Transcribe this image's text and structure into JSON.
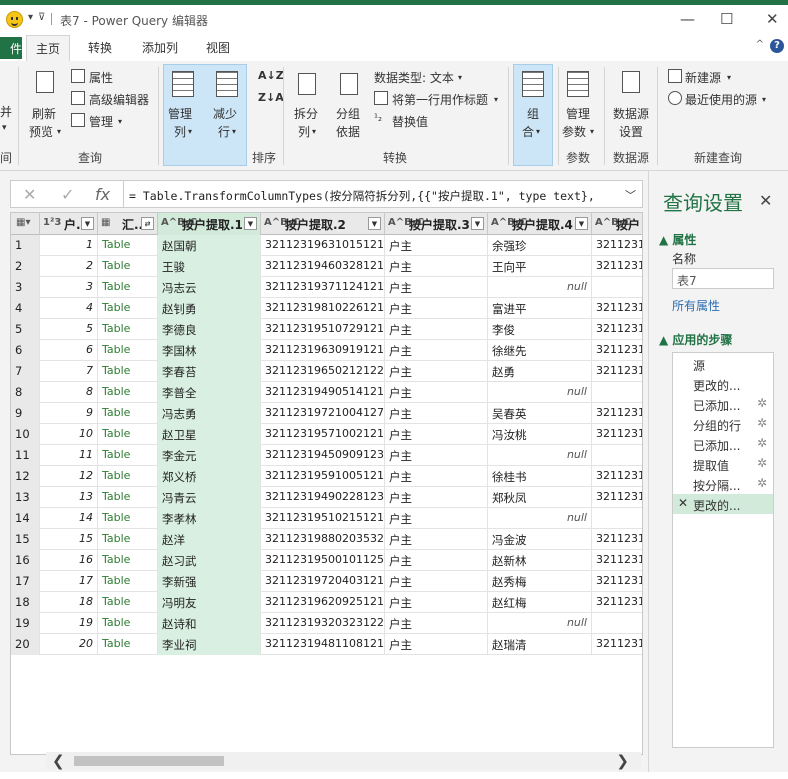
{
  "window": {
    "title": "表7 - Power Query 编辑器",
    "minimize": "—",
    "maximize": "☐",
    "close": "✕"
  },
  "tabs": {
    "file": "件",
    "items": [
      "主页",
      "转换",
      "添加列",
      "视图"
    ]
  },
  "ribbon": {
    "left_edge": [
      "并",
      "▾"
    ],
    "refresh": "刷新",
    "preview": "预览",
    "properties": "属性",
    "advanced_editor": "高级编辑器",
    "manage": "管理",
    "query_group": "查询",
    "manage_columns": "管理",
    "manage_columns2": "列",
    "reduce_rows": "减少",
    "reduce_rows2": "行",
    "sort_group": "排序",
    "split": "拆分",
    "split2": "列",
    "group_by": "分组",
    "group_by2": "依据",
    "data_type": "数据类型: 文本",
    "first_row_header": "将第一行用作标题",
    "replace_values": "替换值",
    "transform_group": "转换",
    "combine": "组",
    "combine2": "合",
    "manage_params": "管理",
    "manage_params2": "参数",
    "params_group": "参数",
    "data_source": "数据源",
    "data_source2": "设置",
    "datasource_group": "数据源",
    "new_source": "新建源",
    "recent_sources": "最近使用的源",
    "new_query_group": "新建查询",
    "left_group": "间"
  },
  "formula": {
    "cancel": "✕",
    "confirm": "✓",
    "fx": "fx",
    "text": "= Table.TransformColumnTypes(按分隔符拆分列,{{\"按户提取.1\", type text},",
    "dropdown": "﹀"
  },
  "columns": [
    {
      "type": "1²3",
      "name": "户..."
    },
    {
      "type": "▦",
      "name": "汇..."
    },
    {
      "type": "A^B_C",
      "name": "按户提取.1"
    },
    {
      "type": "A^B_C",
      "name": "按户提取.2"
    },
    {
      "type": "A^B_C",
      "name": "按户提取.3"
    },
    {
      "type": "A^B_C",
      "name": "按户提取.4"
    },
    {
      "type": "A^B_C",
      "name": "按户"
    }
  ],
  "table_label": "Table",
  "null_label": "null",
  "rows": [
    {
      "n": "1",
      "num": "1",
      "c1": "赵国朝",
      "c2": "321123196310151215",
      "c3": "户主",
      "c4": "余强珍",
      "c5": "32112319"
    },
    {
      "n": "2",
      "num": "2",
      "c1": "王骏",
      "c2": "321123194603281217",
      "c3": "户主",
      "c4": "王向平",
      "c5": "32112319"
    },
    {
      "n": "3",
      "num": "3",
      "c1": "冯志云",
      "c2": "321123193711241218",
      "c3": "户主",
      "c4": "",
      "c5": ""
    },
    {
      "n": "4",
      "num": "4",
      "c1": "赵钊勇",
      "c2": "321123198102261216",
      "c3": "户主",
      "c4": "富进平",
      "c5": "32112319"
    },
    {
      "n": "5",
      "num": "5",
      "c1": "李德良",
      "c2": "321123195107291218",
      "c3": "户主",
      "c4": "李俊",
      "c5": "32112319"
    },
    {
      "n": "6",
      "num": "6",
      "c1": "李国林",
      "c2": "32112319630919121X",
      "c3": "户主",
      "c4": "徐继先",
      "c5": "32112319"
    },
    {
      "n": "7",
      "num": "7",
      "c1": "李春苔",
      "c2": "321123196502121221",
      "c3": "户主",
      "c4": "赵勇",
      "c5": "32112319"
    },
    {
      "n": "8",
      "num": "8",
      "c1": "李普全",
      "c2": "32112319490514121X",
      "c3": "户主",
      "c4": "",
      "c5": ""
    },
    {
      "n": "9",
      "num": "9",
      "c1": "冯志勇",
      "c2": "321123197210041275",
      "c3": "户主",
      "c4": "吴春英",
      "c5": "32112319"
    },
    {
      "n": "10",
      "num": "10",
      "c1": "赵卫星",
      "c2": "321123195710021212",
      "c3": "户主",
      "c4": "冯汝桃",
      "c5": "32112319"
    },
    {
      "n": "11",
      "num": "11",
      "c1": "李金元",
      "c2": "321123194509091230",
      "c3": "户主",
      "c4": "",
      "c5": ""
    },
    {
      "n": "12",
      "num": "12",
      "c1": "郑义桥",
      "c2": "321123195910051213",
      "c3": "户主",
      "c4": "徐桂书",
      "c5": "32112319"
    },
    {
      "n": "13",
      "num": "13",
      "c1": "冯青云",
      "c2": "321123194902281233",
      "c3": "户主",
      "c4": "郑秋凤",
      "c5": "32112319"
    },
    {
      "n": "14",
      "num": "14",
      "c1": "李孝林",
      "c2": "321123195102151216",
      "c3": "户主",
      "c4": "",
      "c5": ""
    },
    {
      "n": "15",
      "num": "15",
      "c1": "赵洋",
      "c2": "32112319880203532X",
      "c3": "户主",
      "c4": "冯金波",
      "c5": "32112319"
    },
    {
      "n": "16",
      "num": "16",
      "c1": "赵习武",
      "c2": "321123195001011257",
      "c3": "户主",
      "c4": "赵新林",
      "c5": "32112319"
    },
    {
      "n": "17",
      "num": "17",
      "c1": "李新强",
      "c2": "321123197204031214",
      "c3": "户主",
      "c4": "赵秀梅",
      "c5": "32112319"
    },
    {
      "n": "18",
      "num": "18",
      "c1": "冯明友",
      "c2": "321123196209251211",
      "c3": "户主",
      "c4": "赵红梅",
      "c5": "32112319"
    },
    {
      "n": "19",
      "num": "19",
      "c1": "赵诗和",
      "c2": "321123193203231223",
      "c3": "户主",
      "c4": "",
      "c5": ""
    },
    {
      "n": "20",
      "num": "20",
      "c1": "李业祠",
      "c2": "32112319481108121X",
      "c3": "户主",
      "c4": "赵瑞清",
      "c5": "32112319"
    }
  ],
  "scroll": {
    "left": "❮",
    "right": "❯"
  },
  "panel": {
    "title": "查询设置",
    "close": "✕",
    "properties_section": "▲ 属性",
    "name_label": "名称",
    "name_value": "表7",
    "all_properties": "所有属性",
    "steps_section": "▲ 应用的步骤",
    "steps": [
      "源",
      "更改的...",
      "已添加...",
      "分组的行",
      "已添加...",
      "提取值",
      "按分隔...",
      "更改的..."
    ],
    "gear": "✲"
  }
}
